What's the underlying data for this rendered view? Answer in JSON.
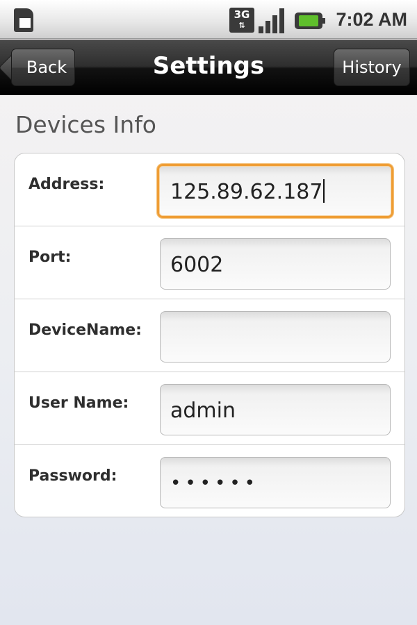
{
  "status_bar": {
    "network": "3G",
    "time": "7:02 AM",
    "signal_level": 4,
    "battery_level": 1.0,
    "icons": [
      "sim-icon",
      "3g-icon",
      "signal-icon",
      "battery-icon"
    ]
  },
  "title_bar": {
    "title": "Settings",
    "back_label": "Back",
    "history_label": "History"
  },
  "section": {
    "title": "Devices Info"
  },
  "form": {
    "fields": [
      {
        "label": "Address:",
        "value": "125.89.62.187",
        "focused": true
      },
      {
        "label": "Port:",
        "value": "6002"
      },
      {
        "label": "DeviceName:",
        "value": ""
      },
      {
        "label": "User Name:",
        "value": "admin"
      },
      {
        "label": "Password:",
        "value": "••••••",
        "masked": true
      }
    ]
  },
  "colors": {
    "focus_border": "#ef9d34",
    "title_bar": "#1a1a1a"
  }
}
